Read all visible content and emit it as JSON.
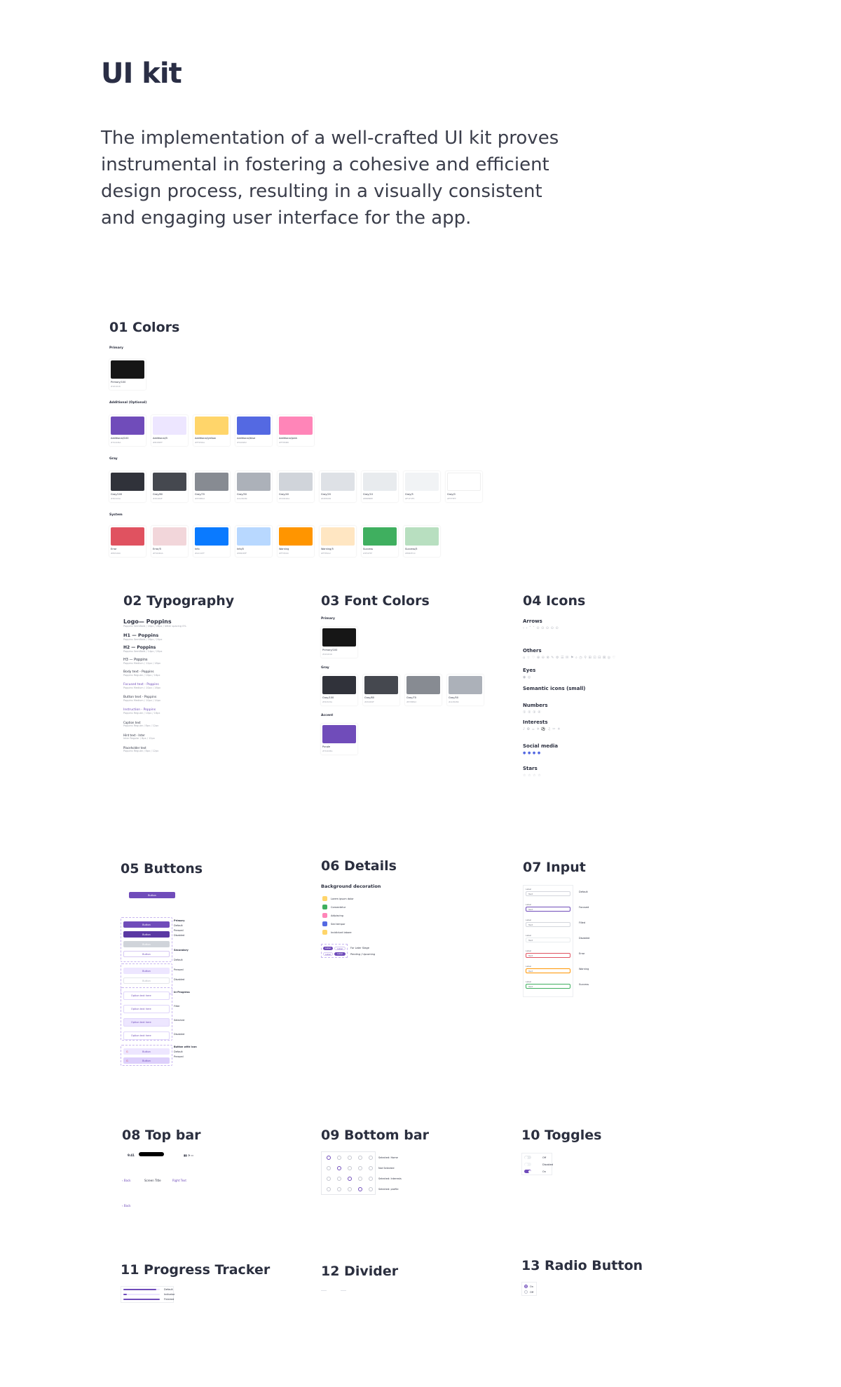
{
  "page": {
    "title": "UI kit",
    "intro": "The implementation of a well-crafted UI kit proves instrumental in fostering a cohesive and efficient design process, resulting in a visually consistent and engaging user interface for the app."
  },
  "colors": {
    "title": "01 Colors",
    "primary_label": "Primary",
    "primary": [
      {
        "name": "Primary/100",
        "hex": "#161616",
        "color": "#161616"
      }
    ],
    "additional_label": "Additional (Optional)",
    "additional": [
      {
        "name": "Additional/100",
        "hex": "#704CBA",
        "color": "#704cba"
      },
      {
        "name": "Additional/5",
        "hex": "#EDE6FF",
        "color": "#ede6ff"
      },
      {
        "name": "Additional/yellow",
        "hex": "#FFD56A",
        "color": "#ffd56a"
      },
      {
        "name": "Additional/blue",
        "hex": "#5469E2",
        "color": "#5469e2"
      },
      {
        "name": "Additional/pink",
        "hex": "#FF85B8",
        "color": "#ff85b8"
      }
    ],
    "gray_label": "Gray",
    "gray": [
      {
        "name": "Gray/100",
        "hex": "#30323A",
        "color": "#30323a"
      },
      {
        "name": "Gray/80",
        "hex": "#45484F",
        "color": "#45484f"
      },
      {
        "name": "Gray/70",
        "hex": "#878B92",
        "color": "#878b92"
      },
      {
        "name": "Gray/50",
        "hex": "#ACB1B9",
        "color": "#acb1b9"
      },
      {
        "name": "Gray/40",
        "hex": "#D0D4DA",
        "color": "#d0d4da"
      },
      {
        "name": "Gray/20",
        "hex": "#DEE1E6",
        "color": "#dee1e6"
      },
      {
        "name": "Gray/10",
        "hex": "#E8EBEE",
        "color": "#e8ebee"
      },
      {
        "name": "Gray/5",
        "hex": "#F1F3F5",
        "color": "#f1f3f5"
      },
      {
        "name": "Gray/0",
        "hex": "#FFFFFF",
        "color": "#ffffff"
      }
    ],
    "system_label": "System",
    "system": [
      {
        "name": "Error",
        "hex": "#E05260",
        "color": "#e05260"
      },
      {
        "name": "Error/5",
        "hex": "#F2D6DA",
        "color": "#f2d6da"
      },
      {
        "name": "Info",
        "hex": "#0A7AFF",
        "color": "#0a7aff"
      },
      {
        "name": "Info/5",
        "hex": "#B8D8FF",
        "color": "#b8d8ff"
      },
      {
        "name": "Warning",
        "hex": "#FF9500",
        "color": "#ff9500"
      },
      {
        "name": "Warning/5",
        "hex": "#FFE6C2",
        "color": "#ffe6c2"
      },
      {
        "name": "Success",
        "hex": "#3FAF5F",
        "color": "#3faf5f"
      },
      {
        "name": "Success/5",
        "hex": "#B8DFC0",
        "color": "#b8dfc0"
      }
    ]
  },
  "typography": {
    "title": "02 Typography",
    "rows": [
      {
        "label": "Logo— Poppins",
        "desc": "Poppins SemiBold / 20px / 28px / letter spacing 0%"
      },
      {
        "label": "H1 — Poppins",
        "desc": "Poppins SemiBold / 16px / 24px"
      },
      {
        "label": "H2 — Poppins",
        "desc": "Poppins SemiBold / 14px / 20px"
      },
      {
        "label": "H3 — Poppins",
        "desc": "Poppins Medium / 12px / 18px"
      },
      {
        "label": "Body text - Poppins",
        "desc": "Poppins Regular / 10px / 16px"
      },
      {
        "label": "Focused text - Poppins",
        "desc": "Poppins Medium / 10px / 16px"
      },
      {
        "label": "Button text - Poppins",
        "desc": "Poppins Medium / 10px / 14px"
      },
      {
        "label": "Instruction - Poppins",
        "desc": "Poppins Regular / 10px / 16px"
      },
      {
        "label": "Caption text",
        "desc": "Poppins Regular / 8px / 12px"
      },
      {
        "label": "Hint text - Inter",
        "desc": "Inter Regular / 8px / 12px"
      },
      {
        "label": "Placeholder text",
        "desc": "Poppins Regular / 8px / 12px"
      }
    ]
  },
  "font_colors": {
    "title": "03 Font Colors",
    "primary_label": "Primary",
    "primary": [
      {
        "name": "Primary/100",
        "hex": "#161616",
        "color": "#161616"
      }
    ],
    "gray_label": "Gray",
    "gray": [
      {
        "name": "Gray/100",
        "hex": "#30323A",
        "color": "#30323a"
      },
      {
        "name": "Gray/80",
        "hex": "#45484F",
        "color": "#45484f"
      },
      {
        "name": "Gray/70",
        "hex": "#878B92",
        "color": "#878b92"
      },
      {
        "name": "Gray/50",
        "hex": "#ACB1B9",
        "color": "#acb1b9"
      }
    ],
    "accent_label": "Accent",
    "accent": [
      {
        "name": "Purple",
        "hex": "#704CBA",
        "color": "#704cba"
      }
    ]
  },
  "icons": {
    "title": "04 Icons",
    "groups": [
      {
        "label": "Arrows",
        "glyphs": "‹ › ˄ ˅ ⊙ ⊙ ⊙ ⊙ ⊙"
      },
      {
        "label": "Others",
        "glyphs": "⌂ ☆ ♡ ⊕ ⊖ ⊗ ✎ ⚙ ☰ ✉ ⚑ ⌕ ◷ ⚲ ⊞ ⊡ ⊟ ⊠ ◎ ♡"
      },
      {
        "label": "Eyes",
        "glyphs": "◉ ◎"
      },
      {
        "label": "Semantic icons (small)",
        "glyphs": ""
      },
      {
        "label": "Numbers",
        "glyphs": "① ② ③ ④"
      },
      {
        "label": "Interests",
        "glyphs": "♪ ✿ ☕ ✈ ⚽ ♫ ✂ ☀"
      },
      {
        "label": "Social media",
        "glyphs": "● ● ● ●"
      },
      {
        "label": "Stars",
        "glyphs": "☆ ☆ ☆ ☆"
      }
    ]
  },
  "buttons": {
    "title": "05 Buttons",
    "button_label": "Button",
    "states_primary": [
      "Primary",
      "Default",
      "Pressed",
      "Disabled"
    ],
    "states_secondary": [
      "Secondary",
      "Default",
      "Pressed",
      "Disabled"
    ],
    "states_text": [
      "Text buttons",
      "Default",
      "Pressed",
      "Disabled"
    ],
    "option_states": [
      "In-Progress",
      "Filter",
      "Selected",
      "Disabled"
    ],
    "option_text": "Option text here",
    "icon_states": [
      "Button with Icon",
      "Default",
      "Pressed"
    ]
  },
  "details": {
    "title": "06 Details",
    "bg_label": "Background decoration",
    "items": [
      {
        "label": "Lorem ipsum dolor",
        "color": "#ffd56a"
      },
      {
        "label": "Consectetur",
        "color": "#3faf5f"
      },
      {
        "label": "Adipiscing",
        "color": "#ff85b8"
      },
      {
        "label": "Sed tempor",
        "color": "#5469e2"
      },
      {
        "label": "Incididunt labore",
        "color": "#ffd56a"
      }
    ],
    "tags": [
      "Label",
      "Label"
    ],
    "tag_labels": [
      "For Later Stage",
      "Pending / Upcoming"
    ]
  },
  "input": {
    "title": "07 Input",
    "label": "Label",
    "placeholder": "Text",
    "states": [
      "Default",
      "Focused",
      "Filled",
      "Disabled",
      "Error",
      "Warning",
      "Success"
    ]
  },
  "top_bar": {
    "title": "08 Top bar",
    "time": "9:41",
    "back": "‹ Back",
    "screen_title": "Screen Title",
    "right_text": "Right Text",
    "back2": "‹ Back"
  },
  "bottom_bar": {
    "title": "09 Bottom bar",
    "labels": [
      "Selected: Home",
      "Not Selected",
      "Selected: Interests",
      "Selected: profile"
    ]
  },
  "toggles": {
    "title": "10  Toggles",
    "labels": [
      "Off",
      "Disabled",
      "On"
    ]
  },
  "progress": {
    "title": "11  Progress Tracker",
    "labels": [
      "Default",
      "Indicator",
      "Finished"
    ],
    "values": [
      0.9,
      0.1,
      1.0
    ]
  },
  "divider": {
    "title": "12 Divider"
  },
  "radio": {
    "title": "13 Radio Button",
    "labels": [
      "On",
      "Off"
    ]
  }
}
